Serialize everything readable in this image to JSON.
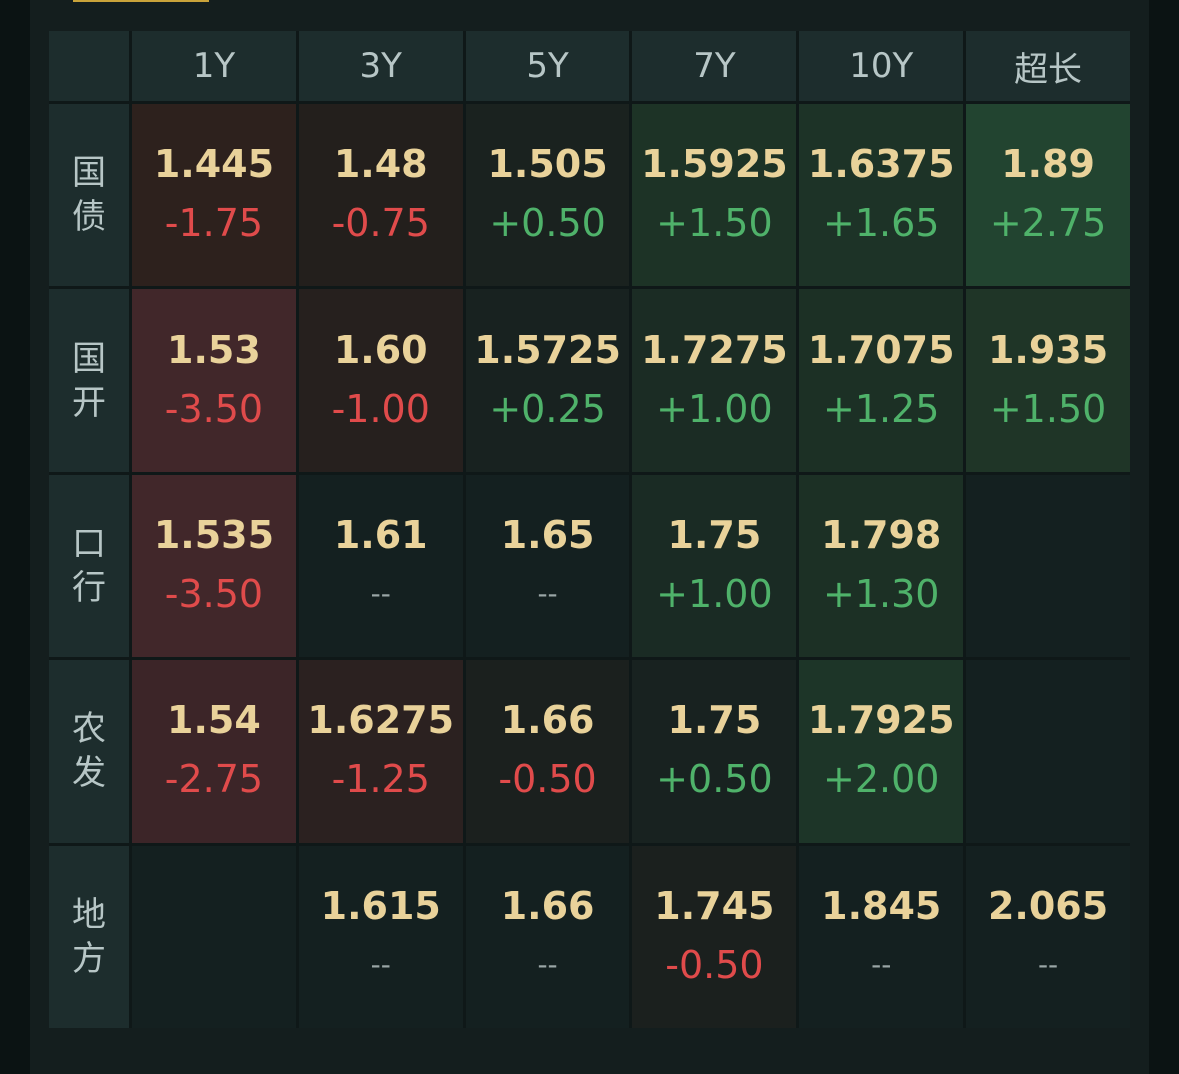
{
  "headers": [
    "1Y",
    "3Y",
    "5Y",
    "7Y",
    "10Y",
    "超长"
  ],
  "rows": [
    {
      "label": [
        "国",
        "债"
      ],
      "cells": [
        {
          "y": "1.445",
          "c": "-1.75",
          "dir": "down",
          "bg": "#2d211d"
        },
        {
          "y": "1.48",
          "c": "-0.75",
          "dir": "down",
          "bg": "#231f1c"
        },
        {
          "y": "1.505",
          "c": "+0.50",
          "dir": "up",
          "bg": "#1a221f"
        },
        {
          "y": "1.5925",
          "c": "+1.50",
          "dir": "up",
          "bg": "#1d3326"
        },
        {
          "y": "1.6375",
          "c": "+1.65",
          "dir": "up",
          "bg": "#1d3327"
        },
        {
          "y": "1.89",
          "c": "+2.75",
          "dir": "up",
          "bg": "#224430"
        }
      ]
    },
    {
      "label": [
        "国",
        "开"
      ],
      "cells": [
        {
          "y": "1.53",
          "c": "-3.50",
          "dir": "down",
          "bg": "#41272a"
        },
        {
          "y": "1.60",
          "c": "-1.00",
          "dir": "down",
          "bg": "#26201e"
        },
        {
          "y": "1.5725",
          "c": "+0.25",
          "dir": "up",
          "bg": "#182220"
        },
        {
          "y": "1.7275",
          "c": "+1.00",
          "dir": "up",
          "bg": "#1b2c24"
        },
        {
          "y": "1.7075",
          "c": "+1.25",
          "dir": "up",
          "bg": "#1c3025"
        },
        {
          "y": "1.935",
          "c": "+1.50",
          "dir": "up",
          "bg": "#1f3527"
        }
      ]
    },
    {
      "label": [
        "口",
        "行"
      ],
      "cells": [
        {
          "y": "1.535",
          "c": "-3.50",
          "dir": "down",
          "bg": "#41272a"
        },
        {
          "y": "1.61",
          "c": "--",
          "dir": "flat",
          "bg": "#142020"
        },
        {
          "y": "1.65",
          "c": "--",
          "dir": "flat",
          "bg": "#142020"
        },
        {
          "y": "1.75",
          "c": "+1.00",
          "dir": "up",
          "bg": "#1a2b24"
        },
        {
          "y": "1.798",
          "c": "+1.30",
          "dir": "up",
          "bg": "#1c3025"
        },
        {
          "y": "",
          "c": "",
          "dir": "flat",
          "bg": "#142020"
        }
      ]
    },
    {
      "label": [
        "农",
        "发"
      ],
      "cells": [
        {
          "y": "1.54",
          "c": "-2.75",
          "dir": "down",
          "bg": "#3c2528"
        },
        {
          "y": "1.6275",
          "c": "-1.25",
          "dir": "down",
          "bg": "#2b2120"
        },
        {
          "y": "1.66",
          "c": "-0.50",
          "dir": "down",
          "bg": "#1b201e"
        },
        {
          "y": "1.75",
          "c": "+0.50",
          "dir": "up",
          "bg": "#182220"
        },
        {
          "y": "1.7925",
          "c": "+2.00",
          "dir": "up",
          "bg": "#1d3528"
        },
        {
          "y": "",
          "c": "",
          "dir": "flat",
          "bg": "#142020"
        }
      ]
    },
    {
      "label": [
        "地",
        "方"
      ],
      "cells": [
        {
          "y": "",
          "c": "",
          "dir": "flat",
          "bg": "#142020"
        },
        {
          "y": "1.615",
          "c": "--",
          "dir": "flat",
          "bg": "#142020"
        },
        {
          "y": "1.66",
          "c": "--",
          "dir": "flat",
          "bg": "#142020"
        },
        {
          "y": "1.745",
          "c": "-0.50",
          "dir": "down",
          "bg": "#1b201e"
        },
        {
          "y": "1.845",
          "c": "--",
          "dir": "flat",
          "bg": "#142020"
        },
        {
          "y": "2.065",
          "c": "--",
          "dir": "flat",
          "bg": "#142020"
        }
      ]
    }
  ]
}
